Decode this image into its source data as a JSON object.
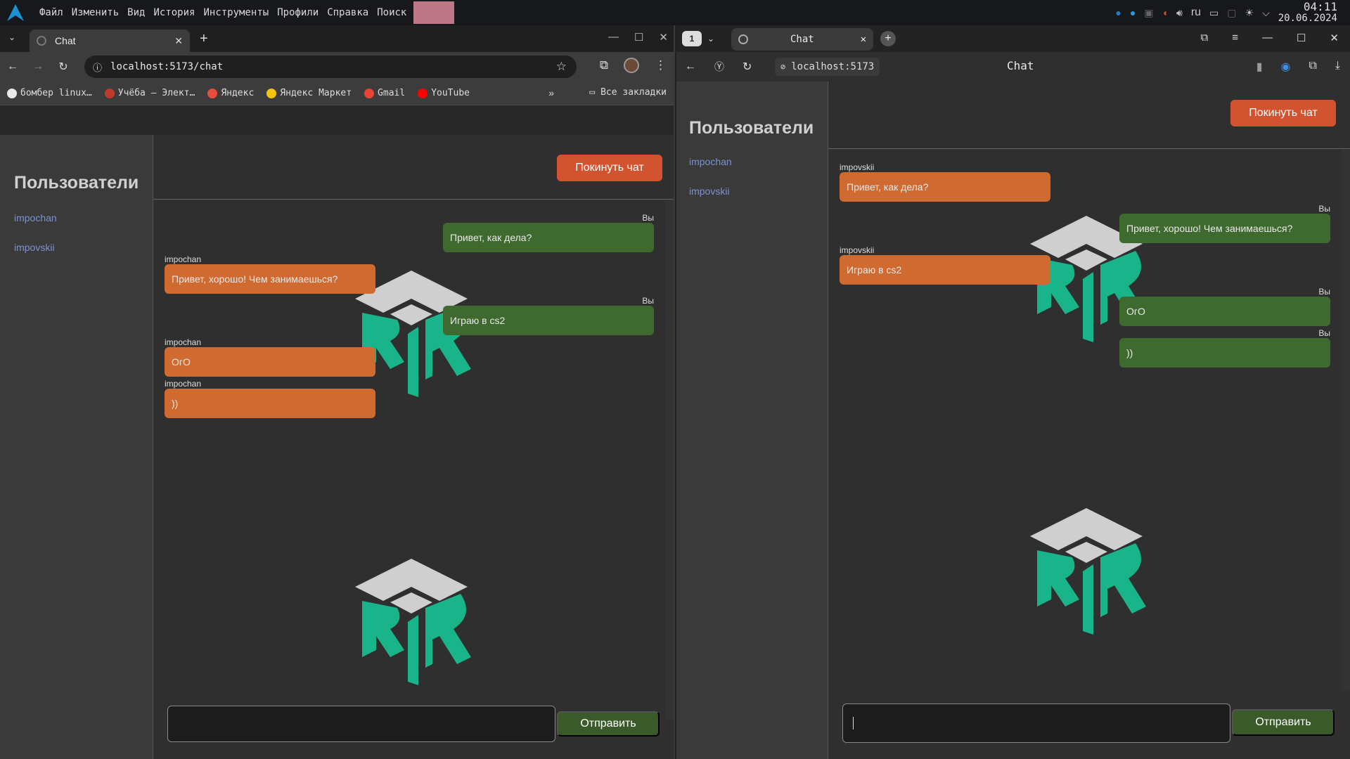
{
  "system_panel": {
    "menu": [
      "Файл",
      "Изменить",
      "Вид",
      "История",
      "Инструменты",
      "Профили",
      "Справка",
      "Поиск"
    ],
    "lang": "ru",
    "time": "04:11",
    "date": "20.06.2024"
  },
  "left_browser": {
    "tab_title": "Chat",
    "url": "localhost:5173/chat",
    "bookmarks": [
      {
        "label": "бомбер linux…",
        "color": "#e8e8e8"
      },
      {
        "label": "Учёба — Элект…",
        "color": "#c0392b"
      },
      {
        "label": "Яндекс",
        "color": "#e74c3c"
      },
      {
        "label": "Яндекс Маркет",
        "color": "#f1c40f"
      },
      {
        "label": "Gmail",
        "color": "#ea4335"
      },
      {
        "label": "YouTube",
        "color": "#ff0000"
      }
    ],
    "all_bookmarks": "Все закладки"
  },
  "right_browser": {
    "tab_count": "1",
    "tab_title": "Chat",
    "url": "localhost:5173",
    "page_title": "Chat"
  },
  "chat_left": {
    "sidebar_title": "Пользователи",
    "users": [
      "impochan",
      "impovskii"
    ],
    "leave_label": "Покинуть чат",
    "send_label": "Отправить",
    "messages": [
      {
        "author": "Вы",
        "text": "Привет, как дела?",
        "mine": true
      },
      {
        "author": "impochan",
        "text": "Привет, хорошо! Чем занимаешься?",
        "mine": false
      },
      {
        "author": "Вы",
        "text": "Играю в cs2",
        "mine": true
      },
      {
        "author": "impochan",
        "text": "ОгО",
        "mine": false
      },
      {
        "author": "impochan",
        "text": "))",
        "mine": false
      }
    ]
  },
  "chat_right": {
    "sidebar_title": "Пользователи",
    "users": [
      "impochan",
      "impovskii"
    ],
    "leave_label": "Покинуть чат",
    "send_label": "Отправить",
    "messages": [
      {
        "author": "impovskii",
        "text": "Привет, как дела?",
        "mine": false
      },
      {
        "author": "Вы",
        "text": "Привет, хорошо! Чем занимаешься?",
        "mine": true
      },
      {
        "author": "impovskii",
        "text": "Играю в cs2",
        "mine": false
      },
      {
        "author": "Вы",
        "text": "ОгО",
        "mine": true
      },
      {
        "author": "Вы",
        "text": "))",
        "mine": true
      }
    ]
  },
  "colors": {
    "accent_leave": "#d2532f",
    "bubble_them": "#cf6a30",
    "bubble_me": "#3f6a2f",
    "emblem_green": "#19b48a",
    "emblem_grey": "#cfcfcf"
  }
}
